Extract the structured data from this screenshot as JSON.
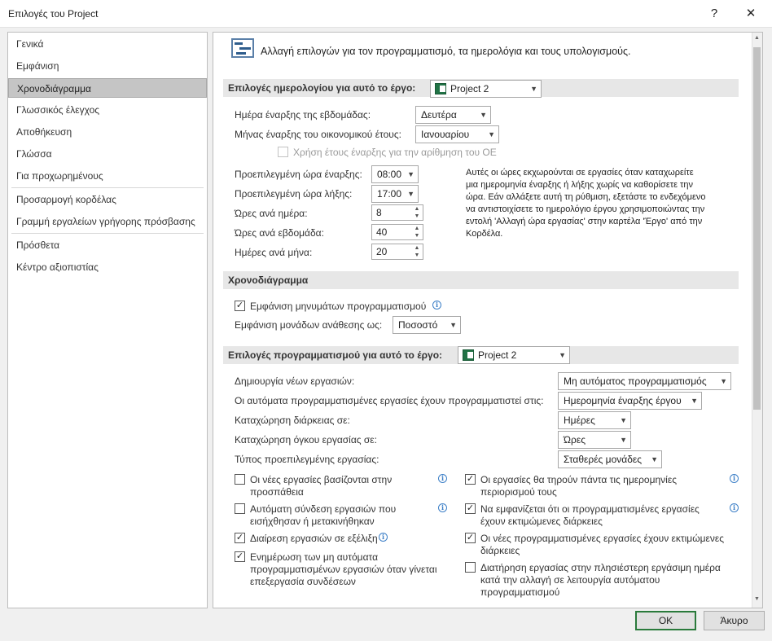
{
  "window": {
    "title": "Επιλογές του Project",
    "help_label": "?",
    "close_label": "✕"
  },
  "sidebar": {
    "items": [
      {
        "label": "Γενικά"
      },
      {
        "label": "Εμφάνιση"
      },
      {
        "label": "Χρονοδιάγραμμα"
      },
      {
        "label": "Γλωσσικός έλεγχος"
      },
      {
        "label": "Αποθήκευση"
      },
      {
        "label": "Γλώσσα"
      },
      {
        "label": "Για προχωρημένους"
      },
      {
        "label": "Προσαρμογή κορδέλας"
      },
      {
        "label": "Γραμμή εργαλείων γρήγορης πρόσβασης"
      },
      {
        "label": "Πρόσθετα"
      },
      {
        "label": "Κέντρο αξιοπιστίας"
      }
    ],
    "selected": "Χρονοδιάγραμμα"
  },
  "header": {
    "text": "Αλλαγή επιλογών για τον προγραμματισμό, τα ημερολόγια και τους υπολογισμούς."
  },
  "calendar": {
    "section_title": "Επιλογές ημερολογίου για αυτό το έργο:",
    "project": "Project 2",
    "week_start_label": "Ημέρα έναρξης της εβδομάδας:",
    "week_start_value": "Δευτέρα",
    "fiscal_month_label": "Μήνας έναρξης του οικονομικού έτους:",
    "fiscal_month_value": "Ιανουαρίου",
    "fiscal_year_numbering": "Χρήση έτους έναρξης για την αρίθμηση του ΟΕ",
    "default_start_label": "Προεπιλεγμένη ώρα έναρξης:",
    "default_start_value": "08:00",
    "default_end_label": "Προεπιλεγμένη ώρα λήξης:",
    "default_end_value": "17:00",
    "hours_day_label": "Ώρες ανά ημέρα:",
    "hours_day_value": "8",
    "hours_week_label": "Ώρες ανά εβδομάδα:",
    "hours_week_value": "40",
    "days_month_label": "Ημέρες ανά μήνα:",
    "days_month_value": "20",
    "note_lines": [
      "Αυτές οι ώρες εκχωρούνται σε εργασίες όταν καταχωρείτε",
      "μια ημερομηνία έναρξης ή λήξης χωρίς να καθορίσετε την",
      "ώρα. Εάν αλλάξετε αυτή τη ρύθμιση, εξετάστε το ενδεχόμενο",
      "να αντιστοιχίσετε το ημερολόγιο έργου χρησιμοποιώντας την",
      "εντολή 'Αλλαγή ώρα εργασίας' στην καρτέλα 'Έργο' από την",
      "Κορδέλα."
    ]
  },
  "schedule": {
    "section_title": "Χρονοδιάγραμμα",
    "show_messages": "Εμφάνιση μηνυμάτων προγραμματισμού",
    "assignment_units_label": "Εμφάνιση μονάδων ανάθεσης ως:",
    "assignment_units_value": "Ποσοστό"
  },
  "scheduling": {
    "section_title": "Επιλογές προγραμματισμού για αυτό το έργο:",
    "project": "Project 2",
    "new_tasks_label": "Δημιουργία νέων εργασιών:",
    "new_tasks_value": "Μη αυτόματος προγραμματισμός",
    "auto_scheduled_label": "Οι αυτόματα προγραμματισμένες εργασίες έχουν προγραμματιστεί στις:",
    "auto_scheduled_value": "Ημερομηνία έναρξης έργου",
    "duration_label": "Καταχώρηση διάρκειας σε:",
    "duration_value": "Ημέρες",
    "work_label": "Καταχώρηση όγκου εργασίας σε:",
    "work_value": "Ώρες",
    "task_type_label": "Τύπος προεπιλεγμένης εργασίας:",
    "task_type_value": "Σταθερές μονάδες",
    "left_checks": [
      {
        "lines": [
          "Οι νέες εργασίες βασίζονται στην",
          "προσπάθεια"
        ],
        "checked": false
      },
      {
        "lines": [
          "Αυτόματη σύνδεση εργασιών που",
          "εισήχθησαν ή μετακινήθηκαν"
        ],
        "checked": false
      },
      {
        "lines": [
          "Διαίρεση εργασιών σε εξέλιξη"
        ],
        "checked": true
      },
      {
        "lines": [
          "Ενημέρωση των μη αυτόματα",
          "προγραμματισμένων εργασιών όταν γίνεται",
          "επεξεργασία συνδέσεων"
        ],
        "checked": true
      }
    ],
    "right_checks": [
      {
        "lines": [
          "Οι εργασίες θα τηρούν πάντα τις ημερομηνίες",
          "περιορισμού τους"
        ],
        "checked": true
      },
      {
        "lines": [
          "Να εμφανίζεται ότι οι προγραμματισμένες εργασίες",
          "έχουν εκτιμώμενες διάρκειες"
        ],
        "checked": true
      },
      {
        "lines": [
          "Οι νέες προγραμματισμένες εργασίες έχουν εκτιμώμενες",
          "διάρκειες"
        ],
        "checked": true
      },
      {
        "lines": [
          "Διατήρηση εργασίας στην πλησιέστερη εργάσιμη ημέρα",
          "κατά την αλλαγή σε λειτουργία αυτόματου",
          "προγραμματισμού"
        ],
        "checked": false
      }
    ]
  },
  "footer": {
    "ok_label": "OK",
    "cancel_label": "Άκυρο"
  },
  "icons": {
    "check": "✓",
    "dropdown": "▼",
    "info": "i"
  }
}
